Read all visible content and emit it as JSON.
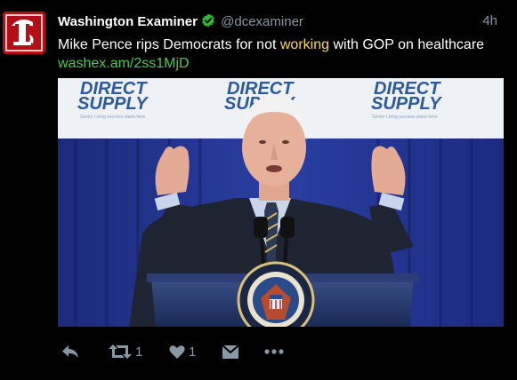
{
  "tweet": {
    "author_name": "Washington Examiner",
    "handle": "@dcexaminer",
    "time": "4h",
    "text_before": "Mike Pence rips Democrats for not ",
    "text_highlight": "working",
    "text_after": " with GOP on healthcare ",
    "link": "washex.am/2ss1MjD"
  },
  "media": {
    "banner_top": "DIRECT",
    "banner_bottom": "SUPPLY",
    "banner_tagline": "Senior Living success starts here"
  },
  "actions": {
    "retweet_count": "1",
    "like_count": "1"
  },
  "icons": {
    "avatar": "washington-examiner-logo",
    "verified": "verified-badge-icon",
    "reply": "reply-icon",
    "retweet": "retweet-icon",
    "like": "heart-icon",
    "dm": "envelope-icon",
    "more": "more-icon"
  },
  "colors": {
    "background": "#000000",
    "verified": "#2eb82e",
    "link": "#3ecf49",
    "highlight": "#ffd84a",
    "muted": "#8899a6",
    "avatar_bg": "#b30f16"
  }
}
